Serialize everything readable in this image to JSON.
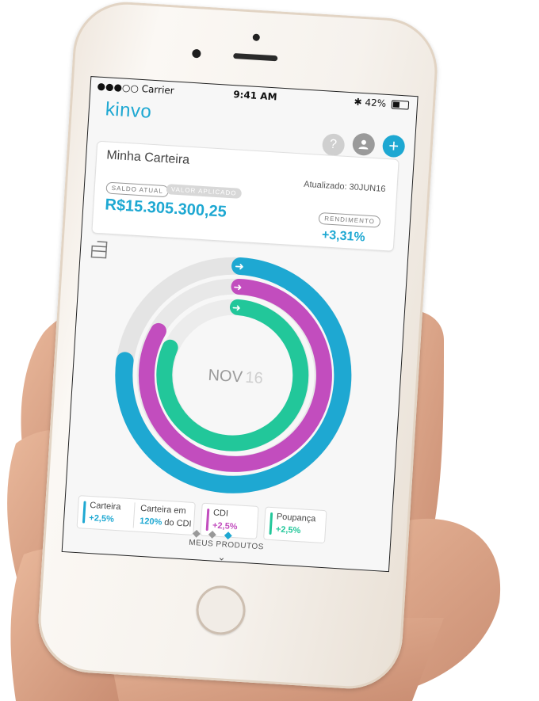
{
  "status_bar": {
    "carrier": "●●●○○ Carrier",
    "time": "9:41 AM",
    "battery": "42%"
  },
  "header": {
    "brand": "kinvo",
    "icons": [
      "help-icon",
      "user-icon",
      "add-icon"
    ],
    "help_glyph": "?",
    "add_glyph": "+"
  },
  "wallet_card": {
    "title": "Minha Carteira",
    "updated": "Atualizado: 30JUN16",
    "tab_saldo": "SALDO ATUAL",
    "tab_valor": "VALOR APLICADO",
    "value": "R$15.305.300,25",
    "rendimento_label": "RENDIMENTO",
    "rendimento_value": "+3,31%"
  },
  "rings": {
    "center_month": "NOV",
    "center_year": "16"
  },
  "legend": {
    "carteira": {
      "name": "Carteira",
      "value": "+2,5%",
      "sub_name": "Carteira em",
      "sub_value_bold": "120%",
      "sub_value_rest": " do CDI"
    },
    "cdi": {
      "name": "CDI",
      "value": "+2,5%"
    },
    "poupanca": {
      "name": "Poupança",
      "value": "+2,5%"
    }
  },
  "footer": {
    "products_label": "MEUS PRODUTOS"
  },
  "colors": {
    "blue": "#1ea8d2",
    "magenta": "#c24dbe",
    "green": "#22c79a"
  }
}
